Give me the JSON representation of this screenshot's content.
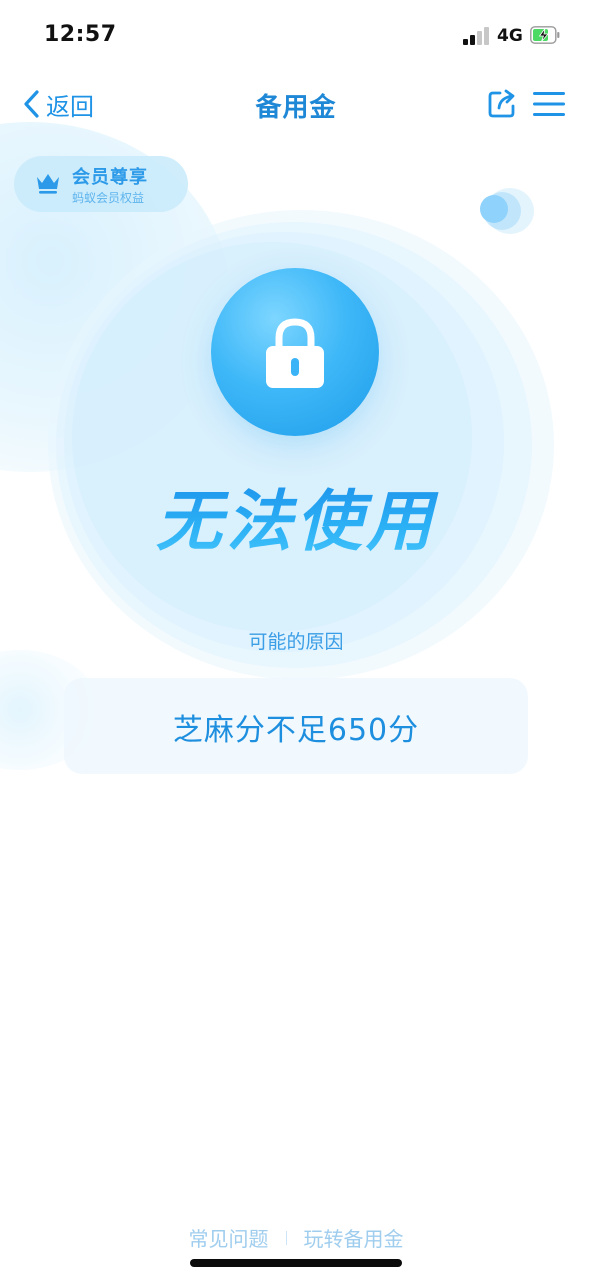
{
  "status_bar": {
    "time": "12:57",
    "network": "4G"
  },
  "nav": {
    "back_label": "返回",
    "title": "备用金"
  },
  "member": {
    "title": "会员尊享",
    "subtitle": "蚂蚁会员权益"
  },
  "status": {
    "headline": "无法使用",
    "reason_label": "可能的原因",
    "reason": "芝麻分不足650分"
  },
  "footer": {
    "links": [
      "常见问题",
      "玩转备用金"
    ]
  },
  "colors": {
    "accent": "#1f93e6",
    "title": "#1f88d6",
    "lock_gradient_start": "#7dd6ff",
    "lock_gradient_end": "#29a6ef",
    "footer_link": "#9fcdee"
  }
}
